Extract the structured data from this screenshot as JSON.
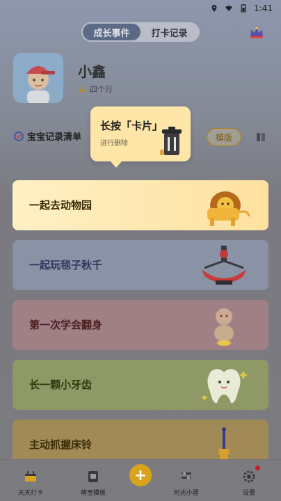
{
  "status_bar": {
    "time": "1:41"
  },
  "top_tabs": [
    {
      "label": "成长事件",
      "active": true
    },
    {
      "label": "打卡记录",
      "active": false
    }
  ],
  "profile": {
    "name": "小鑫",
    "age": "四个月"
  },
  "list": {
    "title": "宝宝记录清单",
    "template_button": "模版"
  },
  "tooltip": {
    "title": "长按「卡片」",
    "subtitle": "进行删除"
  },
  "cards": [
    {
      "label": "一起去动物园",
      "art": "lion-icon"
    },
    {
      "label": "一起玩毯子秋千",
      "art": "swing-icon"
    },
    {
      "label": "第一次学会翻身",
      "art": "baby-icon"
    },
    {
      "label": "长一颗小牙齿",
      "art": "tooth-icon"
    },
    {
      "label": "主动抓握床铃",
      "art": "mobile-icon"
    }
  ],
  "bottom_nav": [
    {
      "label": "天天打卡",
      "icon": "checkin-icon"
    },
    {
      "label": "萌宝模板",
      "icon": "template-icon"
    },
    {
      "label": "时光小屋",
      "icon": "house-icon"
    },
    {
      "label": "设置",
      "icon": "settings-icon"
    }
  ],
  "colors": {
    "accent": "#d9a41c",
    "tab_active": "#4d5d7c",
    "tooltip_bg": "#fde6a7",
    "card_highlight": "#fee1a0"
  }
}
